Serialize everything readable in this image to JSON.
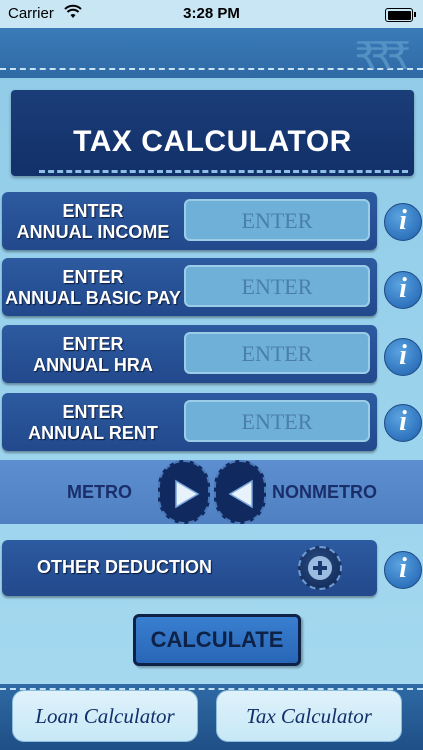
{
  "status": {
    "carrier": "Carrier",
    "time": "3:28 PM"
  },
  "title": "TAX CALCULATOR",
  "rows": [
    {
      "line1": "ENTER",
      "line2": "ANNUAL INCOME",
      "placeholder": "ENTER"
    },
    {
      "line1": "ENTER",
      "line2": "ANNUAL BASIC PAY",
      "placeholder": "ENTER"
    },
    {
      "line1": "ENTER",
      "line2": "ANNUAL HRA",
      "placeholder": "ENTER"
    },
    {
      "line1": "ENTER",
      "line2": "ANNUAL RENT",
      "placeholder": "ENTER"
    }
  ],
  "info_glyph": "i",
  "metro": {
    "metro_label": "METRO",
    "nonmetro_label": "NONMETRO"
  },
  "deduction": {
    "label": "OTHER DEDUCTION"
  },
  "calculate_label": "CALCULATE",
  "tabs": [
    {
      "label": "Loan  Calculator"
    },
    {
      "label": "Tax Calculator"
    }
  ],
  "colors": {
    "title_panel": "#12306a",
    "row_bg": "#2d5aa0",
    "input_bg": "#6fb0d8",
    "accent": "#2f73bd"
  }
}
